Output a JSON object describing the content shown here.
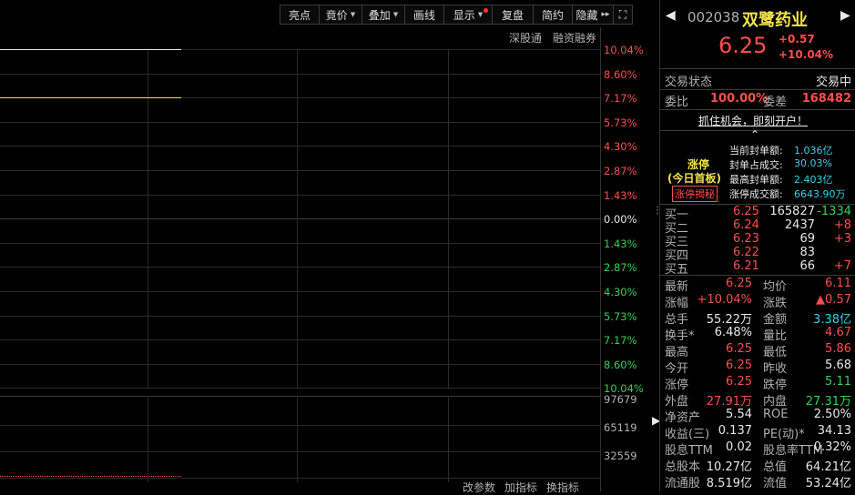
{
  "toolbar": {
    "buttons": [
      {
        "label": "亮点",
        "w": 44
      },
      {
        "label": "竟价",
        "w": 48,
        "arrow": true
      },
      {
        "label": "叠加",
        "w": 48,
        "arrow": true
      },
      {
        "label": "画线",
        "w": 44
      },
      {
        "label": "显示",
        "w": 54,
        "arrow": true,
        "dot": true
      },
      {
        "label": "复盘",
        "w": 46
      },
      {
        "label": "简约",
        "w": 44
      },
      {
        "label": "隐藏",
        "w": 46
      },
      {
        "label": "⛶",
        "w": 22
      }
    ],
    "hide_arrows": "▸▸"
  },
  "chart": {
    "links": {
      "shen_gu_tong": "深股通",
      "rong_zi": "融资融券"
    },
    "pct_labels_up": [
      "10.04%",
      "8.60%",
      "7.17%",
      "5.73%",
      "4.30%",
      "2.87%",
      "1.43%"
    ],
    "pct_zero": "0.00%",
    "pct_labels_down": [
      "1.43%",
      "2.87%",
      "4.30%",
      "5.73%",
      "7.17%",
      "8.60%",
      "10.04%"
    ],
    "volume_labels": [
      "97679",
      "65119",
      "32559"
    ],
    "bottom_links": [
      "改参数",
      "加指标",
      "换指标"
    ],
    "price_line_level": 10.04,
    "avg_line_level": 7.17
  },
  "panel": {
    "code": "002038",
    "name": "双鹭药业",
    "price": "6.25",
    "change": "+0.57",
    "change_pct": "+10.04%",
    "status_label": "交易状态",
    "status_value": "交易中",
    "weibi_label": "委比",
    "weibi_value": "100.00%",
    "weicha_label": "委差",
    "weicha_value": "168482",
    "promo": "抓住机会，即刻开户！",
    "limit_up": {
      "title": "涨停",
      "sub": "(今日首板)",
      "btn": "涨停揭秘",
      "items": [
        {
          "label": "当前封单额:",
          "value": "1.036亿"
        },
        {
          "label": "封单占成交:",
          "value": "30.03%"
        },
        {
          "label": "最高封单额:",
          "value": "2.403亿"
        },
        {
          "label": "涨停成交额:",
          "value": "6643.90万"
        }
      ]
    },
    "bids": [
      {
        "label": "买一",
        "price": "6.25",
        "vol": "165827",
        "chg": "-1334",
        "chg_color": "green"
      },
      {
        "label": "买二",
        "price": "6.24",
        "vol": "2437",
        "chg": "+8",
        "chg_color": "red"
      },
      {
        "label": "买三",
        "price": "6.23",
        "vol": "69",
        "chg": "+3",
        "chg_color": "red"
      },
      {
        "label": "买四",
        "price": "6.22",
        "vol": "83",
        "chg": "",
        "chg_color": "red"
      },
      {
        "label": "买五",
        "price": "6.21",
        "vol": "66",
        "chg": "+7",
        "chg_color": "red"
      }
    ],
    "stats": [
      {
        "l1": "最新",
        "v1": "6.25",
        "c1": "red",
        "l2": "均价",
        "v2": "6.11",
        "c2": "red"
      },
      {
        "l1": "涨幅",
        "v1": "+10.04%",
        "c1": "red",
        "l2": "涨跌",
        "v2": "▲0.57",
        "c2": "red"
      },
      {
        "l1": "总手",
        "v1": "55.22万",
        "c1": "white",
        "l2": "金额",
        "v2": "3.38亿",
        "c2": "cyan"
      },
      {
        "l1": "换手*",
        "v1": "6.48%",
        "c1": "white",
        "l2": "量比",
        "v2": "4.67",
        "c2": "red"
      },
      {
        "l1": "最高",
        "v1": "6.25",
        "c1": "red",
        "l2": "最低",
        "v2": "5.86",
        "c2": "red"
      },
      {
        "l1": "今开",
        "v1": "6.25",
        "c1": "red",
        "l2": "昨收",
        "v2": "5.68",
        "c2": "white"
      },
      {
        "l1": "涨停",
        "v1": "6.25",
        "c1": "red",
        "l2": "跌停",
        "v2": "5.11",
        "c2": "green"
      },
      {
        "l1": "外盘",
        "v1": "27.91万",
        "c1": "red",
        "l2": "内盘",
        "v2": "27.31万",
        "c2": "green"
      },
      {
        "l1": "净资产",
        "v1": "5.54",
        "c1": "white",
        "l2": "ROE",
        "v2": "2.50%",
        "c2": "white"
      },
      {
        "l1": "收益(三)",
        "v1": "0.137",
        "c1": "white",
        "l2": "PE(动)*",
        "v2": "34.13",
        "c2": "white"
      },
      {
        "l1": "股息TTM",
        "v1": "0.02",
        "c1": "white",
        "l2": "股息率TTM",
        "v2": "0.32%",
        "c2": "white"
      },
      {
        "l1": "总股本",
        "v1": "10.27亿",
        "c1": "white",
        "l2": "总值",
        "v2": "64.21亿",
        "c2": "white"
      },
      {
        "l1": "流通股",
        "v1": "8.519亿",
        "c1": "white",
        "l2": "流值",
        "v2": "53.24亿",
        "c2": "white"
      }
    ],
    "colors": {
      "red": "#ff4d4d",
      "green": "#34d058",
      "white": "#e8e8e8",
      "cyan": "#35d2e8",
      "yellow": "#f0e24a"
    }
  }
}
